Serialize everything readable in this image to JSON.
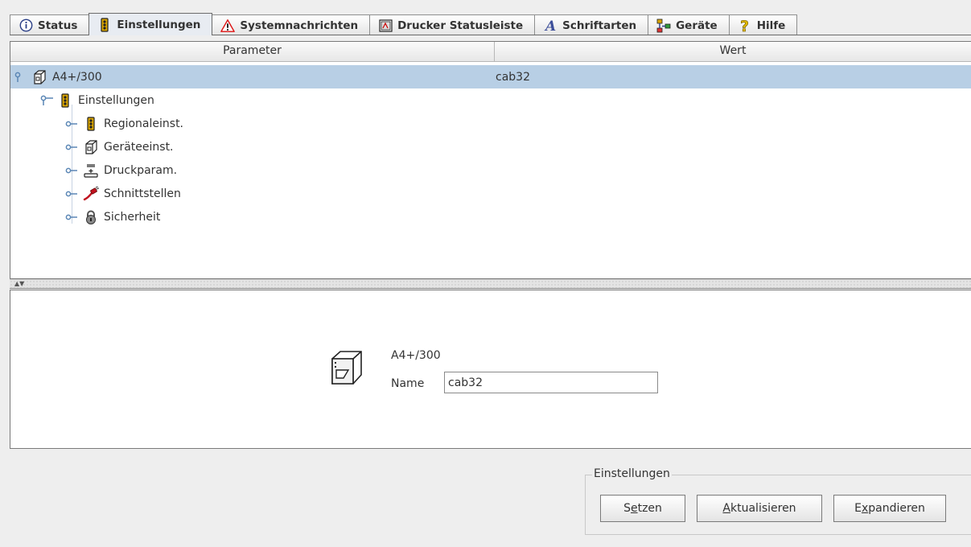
{
  "tabs": [
    {
      "label": "Status",
      "icon": "info-icon"
    },
    {
      "label": "Einstellungen",
      "icon": "traffic-light-icon",
      "active": true
    },
    {
      "label": "Systemnachrichten",
      "icon": "warning-icon"
    },
    {
      "label": "Drucker Statusleiste",
      "icon": "printer-status-icon"
    },
    {
      "label": "Schriftarten",
      "icon": "font-icon"
    },
    {
      "label": "Geräte",
      "icon": "devices-icon"
    },
    {
      "label": "Hilfe",
      "icon": "help-icon"
    }
  ],
  "table": {
    "col_param": "Parameter",
    "col_wert": "Wert"
  },
  "tree": {
    "root": {
      "label": "A4+/300",
      "value": "cab32",
      "icon": "printer-icon"
    },
    "einstellungen": {
      "label": "Einstellungen",
      "icon": "traffic-light-icon"
    },
    "children": [
      {
        "label": "Regionaleinst.",
        "icon": "traffic-light-icon"
      },
      {
        "label": "Geräteeinst.",
        "icon": "printer-icon"
      },
      {
        "label": "Druckparam.",
        "icon": "print-head-icon"
      },
      {
        "label": "Schnittstellen",
        "icon": "cable-plug-icon"
      },
      {
        "label": "Sicherheit",
        "icon": "padlock-icon"
      }
    ]
  },
  "detail": {
    "device_title": "A4+/300",
    "name_label": "Name",
    "name_value": "cab32"
  },
  "group": {
    "legend": "Einstellungen",
    "buttons": [
      {
        "pre": "S",
        "mn": "e",
        "post": "tzen"
      },
      {
        "pre": "",
        "mn": "A",
        "post": "ktualisieren"
      },
      {
        "pre": "E",
        "mn": "x",
        "post": "pandieren"
      }
    ]
  },
  "colors": {
    "selection": "#b8cfe5",
    "tree_handle": "#5a86b5",
    "background": "#eeeeee"
  }
}
